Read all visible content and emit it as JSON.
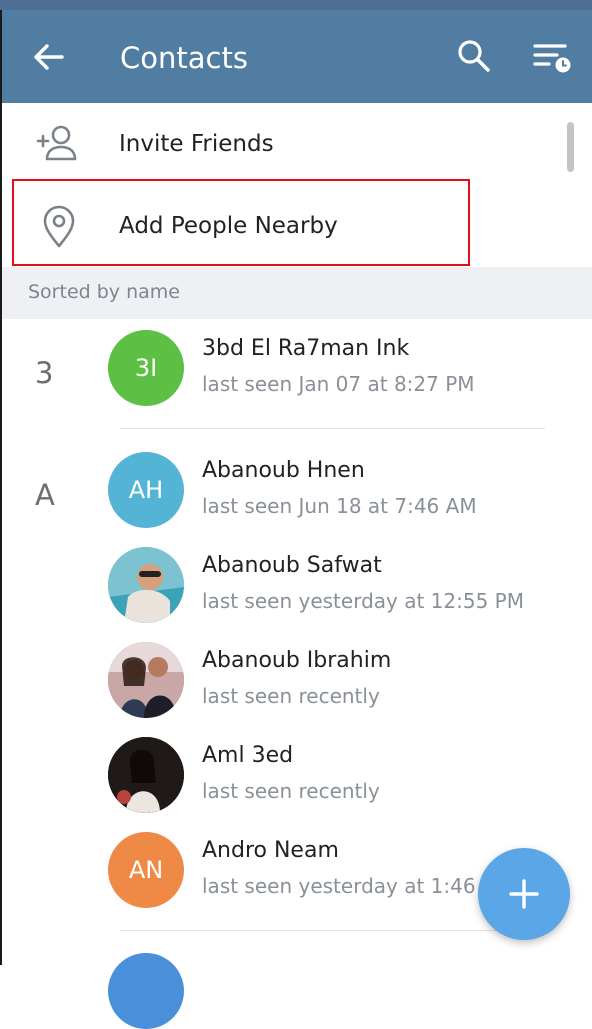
{
  "toolbar": {
    "title": "Contacts"
  },
  "actions": {
    "invite": "Invite Friends",
    "nearby": "Add People Nearby"
  },
  "section_header": "Sorted by name",
  "letters": [
    "3",
    "A"
  ],
  "contacts": [
    {
      "initials": "3I",
      "name": "3bd El Ra7man Ink",
      "status": "last seen Jan 07 at 8:27 PM",
      "color": "#5dbf44"
    },
    {
      "initials": "AH",
      "name": "Abanoub Hnen",
      "status": "last seen Jun 18 at 7:46 AM",
      "color": "#53b4d6"
    },
    {
      "initials": "",
      "name": "Abanoub Safwat",
      "status": "last seen yesterday at 12:55 PM",
      "color": "#6fb8c9"
    },
    {
      "initials": "",
      "name": "Abanoub Ibrahim",
      "status": "last seen recently",
      "color": "#8a5a5a"
    },
    {
      "initials": "",
      "name": "Aml 3ed",
      "status": "last seen recently",
      "color": "#2a2a2a"
    },
    {
      "initials": "AN",
      "name": "Andro Neam",
      "status": "last seen yesterday at 1:46 PM",
      "color": "#ee8a45"
    }
  ]
}
